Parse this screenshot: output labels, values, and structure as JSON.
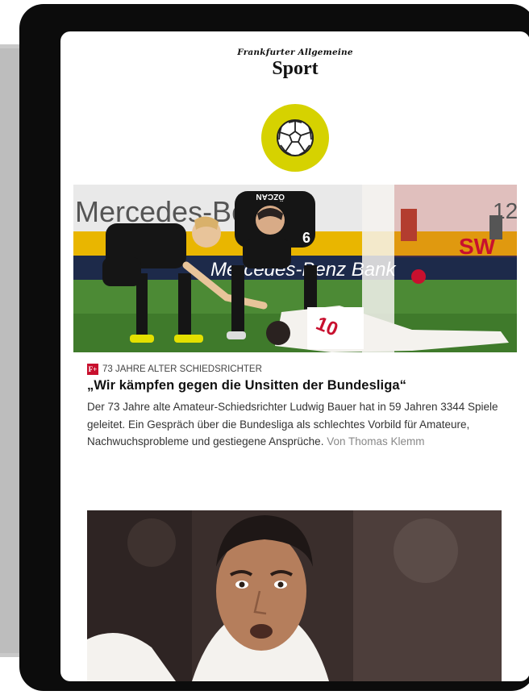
{
  "masthead": {
    "publisher": "Frankfurter Allgemeine",
    "section": "Sport"
  },
  "section_icon": "soccer-ball-icon",
  "colors": {
    "badge_yellow": "#d6d200",
    "plus_red": "#c8102e",
    "device_frame": "#0c0c0c"
  },
  "hero_image": {
    "jersey_number_left": "6",
    "jersey_number_right": "10",
    "name_on_shirt": "ÖZCAN",
    "banner_texts": [
      "Mercedes-Benz",
      "Mercedes-Benz Bank",
      "12",
      "SW"
    ]
  },
  "article1": {
    "badge": "F+",
    "kicker": "73 JAHRE ALTER SCHIEDSRICHTER",
    "headline": "„Wir kämpfen gegen die Unsitten der Bundesliga“",
    "teaser": "Der 73 Jahre alte Amateur-Schiedsrichter Ludwig Bauer hat in 59 Jahren 3344 Spiele geleitet. Ein Gespräch über die Bundesliga als schlechtes Vorbild für Amateure, Nachwuchsprobleme und gestiegene Ansprüche.",
    "author": "Von Thomas Klemm"
  }
}
